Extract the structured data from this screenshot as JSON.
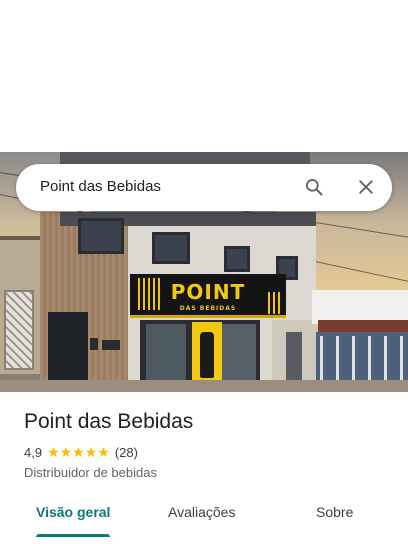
{
  "search": {
    "query": "Point das Bebidas"
  },
  "photo": {
    "sign_title": "POINT",
    "sign_subtitle": "DAS BEBIDAS"
  },
  "place": {
    "name": "Point das Bebidas",
    "rating": "4,9",
    "rating_stars": 5,
    "stars_display": "★★★★★",
    "reviews_count": "(28)",
    "category": "Distribuidor de bebidas"
  },
  "tabs": [
    {
      "label": "Visão geral",
      "selected": true
    },
    {
      "label": "Avaliações",
      "selected": false
    },
    {
      "label": "Sobre",
      "selected": false
    }
  ],
  "colors": {
    "accent": "#0b7a74",
    "star": "#fbbc04",
    "sign": "#f2c811"
  },
  "icons": [
    "search-icon",
    "close-icon"
  ]
}
